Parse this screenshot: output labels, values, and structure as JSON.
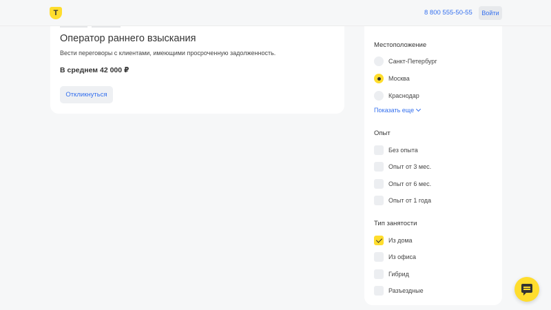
{
  "header": {
    "logo_letter": "T",
    "phone": "8 800 555-50-55",
    "login_label": "Войти"
  },
  "job": {
    "title": "Оператор раннего взыскания",
    "description": "Вести переговоры с клиентами, имеющими просроченную задолженность.",
    "salary": "В среднем 42 000 ₽",
    "respond_label": "Откликнуться"
  },
  "filters": {
    "location": {
      "title": "Местоположение",
      "options": [
        {
          "label": "Санкт-Петербург",
          "selected": false
        },
        {
          "label": "Москва",
          "selected": true
        },
        {
          "label": "Краснодар",
          "selected": false
        }
      ],
      "show_more": "Показать еще"
    },
    "experience": {
      "title": "Опыт",
      "options": [
        {
          "label": "Без опыта",
          "checked": false
        },
        {
          "label": "Опыт от 3 мес.",
          "checked": false
        },
        {
          "label": "Опыт от 6 мес.",
          "checked": false
        },
        {
          "label": "Опыт от 1 года",
          "checked": false
        }
      ]
    },
    "employment": {
      "title": "Тип занятости",
      "options": [
        {
          "label": "Из дома",
          "checked": true
        },
        {
          "label": "Из офиса",
          "checked": false
        },
        {
          "label": "Гибрид",
          "checked": false
        },
        {
          "label": "Разъездные",
          "checked": false
        }
      ]
    }
  },
  "colors": {
    "accent_yellow": "#ffdd2d",
    "link_blue": "#336fee",
    "page_bg": "#f6f7f8"
  },
  "icons": {
    "logo": "tbank-shield-logo",
    "chat": "chat-bubble-icon",
    "chevron": "chevron-down-icon"
  }
}
